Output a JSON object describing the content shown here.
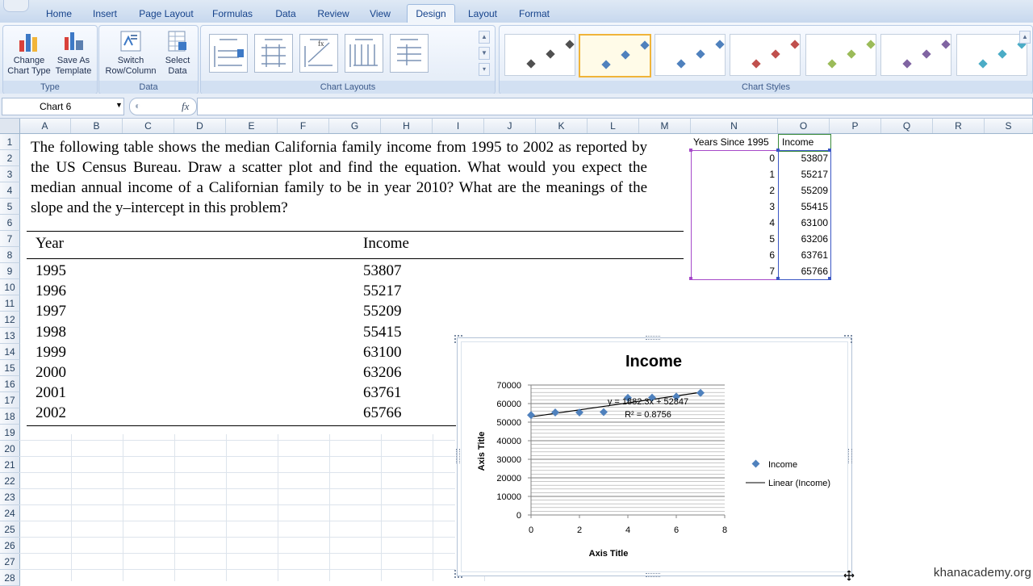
{
  "ribbon": {
    "tabs": [
      "Home",
      "Insert",
      "Page Layout",
      "Formulas",
      "Data",
      "Review",
      "View",
      "Design",
      "Layout",
      "Format"
    ],
    "active_tab": "Design",
    "groups": {
      "type": {
        "label": "Type",
        "change_chart_type": [
          "Change",
          "Chart Type"
        ],
        "save_as_template": [
          "Save As",
          "Template"
        ]
      },
      "data": {
        "label": "Data",
        "switch_row_column": [
          "Switch",
          "Row/Column"
        ],
        "select_data": [
          "Select",
          "Data"
        ]
      },
      "chart_layouts": {
        "label": "Chart Layouts"
      },
      "chart_styles": {
        "label": "Chart Styles",
        "colors": [
          "#505050",
          "#4f81bd",
          "#4f81bd",
          "#c0504d",
          "#9bbb59",
          "#8064a2",
          "#4bacc6"
        ]
      }
    }
  },
  "formula_bar": {
    "name_box": "Chart 6",
    "fx_symbol": "fx",
    "value": ""
  },
  "columns": [
    "A",
    "B",
    "C",
    "D",
    "E",
    "F",
    "G",
    "H",
    "I",
    "J",
    "K",
    "L",
    "M",
    "N",
    "O",
    "P",
    "Q",
    "R",
    "S"
  ],
  "rows": [
    "1",
    "2",
    "3",
    "4",
    "5",
    "6",
    "7",
    "8",
    "9",
    "10",
    "11",
    "12",
    "13",
    "14",
    "15",
    "16",
    "17",
    "18",
    "19",
    "20",
    "21",
    "22",
    "23",
    "24",
    "25",
    "26",
    "27",
    "28"
  ],
  "problem": {
    "text": "The following table shows the median California family income from 1995 to 2002 as reported by the US Census Bureau. Draw a scatter plot and find the equation. What would you expect the median annual income of a Californian family to be in year 2010? What are the meanings of the slope and the y–intercept in this problem?",
    "table_headers": [
      "Year",
      "Income"
    ],
    "table_rows": [
      [
        "1995",
        "53807"
      ],
      [
        "1996",
        "55217"
      ],
      [
        "1997",
        "55209"
      ],
      [
        "1998",
        "55415"
      ],
      [
        "1999",
        "63100"
      ],
      [
        "2000",
        "63206"
      ],
      [
        "2001",
        "63761"
      ],
      [
        "2002",
        "65766"
      ]
    ]
  },
  "sheet_data": {
    "headers": [
      "Years Since 1995",
      "Income"
    ],
    "rows": [
      [
        "0",
        "53807"
      ],
      [
        "1",
        "55217"
      ],
      [
        "2",
        "55209"
      ],
      [
        "3",
        "55415"
      ],
      [
        "4",
        "63100"
      ],
      [
        "5",
        "63206"
      ],
      [
        "6",
        "63761"
      ],
      [
        "7",
        "65766"
      ]
    ]
  },
  "chart_data": {
    "type": "scatter",
    "title": "Income",
    "xlabel": "Axis Title",
    "ylabel": "Axis Title",
    "xlim": [
      0,
      8
    ],
    "ylim": [
      0,
      70000
    ],
    "x_ticks": [
      "0",
      "2",
      "4",
      "6",
      "8"
    ],
    "y_ticks": [
      "0",
      "10000",
      "20000",
      "30000",
      "40000",
      "50000",
      "60000",
      "70000"
    ],
    "grid": true,
    "legend_position": "right",
    "series": [
      {
        "name": "Income",
        "x": [
          0,
          1,
          2,
          3,
          4,
          5,
          6,
          7
        ],
        "y": [
          53807,
          55217,
          55209,
          55415,
          63100,
          63206,
          63761,
          65766
        ],
        "color": "#4f81bd"
      }
    ],
    "trendline": {
      "name": "Linear (Income)",
      "slope": 1882.3,
      "intercept": 52847,
      "color": "#000000"
    },
    "annotations": [
      "y = 1882.3x + 52847",
      "R² = 0.8756"
    ]
  },
  "watermark": "khanacademy.org"
}
